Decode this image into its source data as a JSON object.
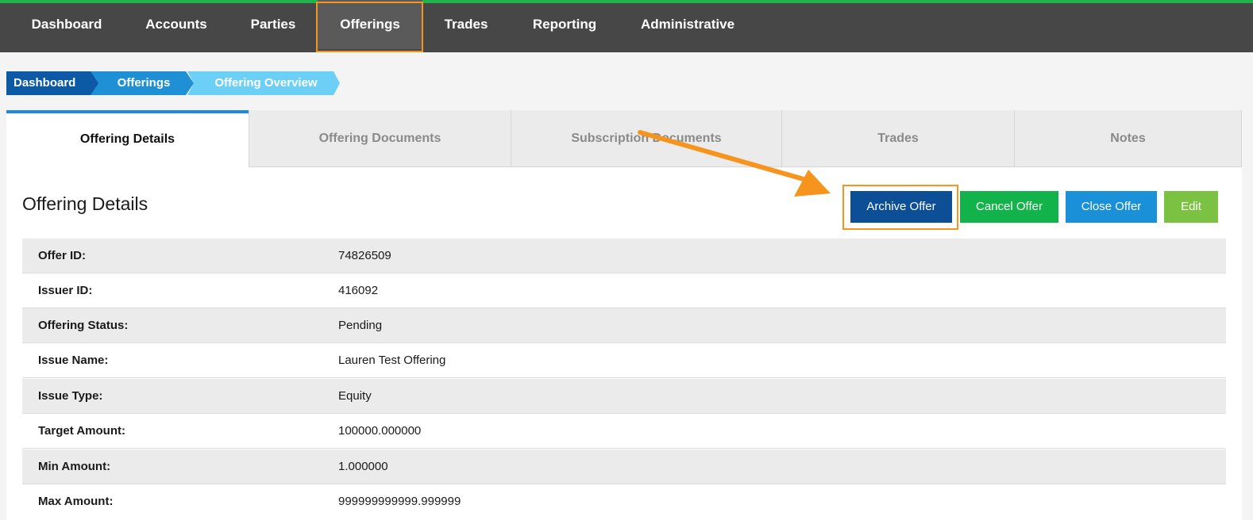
{
  "nav": {
    "items": [
      {
        "label": "Dashboard"
      },
      {
        "label": "Accounts"
      },
      {
        "label": "Parties"
      },
      {
        "label": "Offerings"
      },
      {
        "label": "Trades"
      },
      {
        "label": "Reporting"
      },
      {
        "label": "Administrative"
      }
    ],
    "active": "Offerings"
  },
  "breadcrumb": {
    "items": [
      {
        "label": "Dashboard",
        "color": "#0c5aa6"
      },
      {
        "label": "Offerings",
        "color": "#1f8fd6"
      },
      {
        "label": "Offering Overview",
        "color": "#6ccff6"
      }
    ]
  },
  "tabs": [
    {
      "label": "Offering Details"
    },
    {
      "label": "Offering Documents"
    },
    {
      "label": "Subscription Documents"
    },
    {
      "label": "Trades"
    },
    {
      "label": "Notes"
    }
  ],
  "section": {
    "title": "Offering Details"
  },
  "actions": {
    "archive": "Archive Offer",
    "cancel": "Cancel Offer",
    "close": "Close Offer",
    "edit": "Edit"
  },
  "colors": {
    "archive": "#0c4f96",
    "cancel": "#12b34a",
    "close": "#1a90d9",
    "edit": "#7cc242",
    "highlight": "#f7941d"
  },
  "details": [
    {
      "label": "Offer ID:",
      "value": "74826509"
    },
    {
      "label": "Issuer ID:",
      "value": "416092"
    },
    {
      "label": "Offering Status:",
      "value": "Pending"
    },
    {
      "label": "Issue Name:",
      "value": "Lauren Test Offering"
    },
    {
      "label": "Issue Type:",
      "value": "Equity"
    },
    {
      "label": "Target Amount:",
      "value": "100000.000000"
    },
    {
      "label": "Min Amount:",
      "value": "1.000000"
    },
    {
      "label": "Max Amount:",
      "value": "999999999999.999999"
    }
  ]
}
